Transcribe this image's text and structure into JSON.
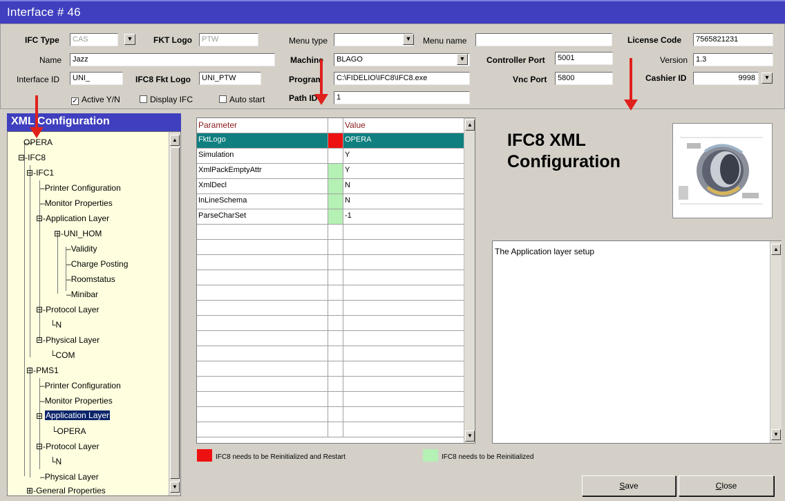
{
  "window": {
    "title": "Interface # 46"
  },
  "header": {
    "ifc_type": {
      "label": "IFC Type",
      "value": "CAS"
    },
    "fkt_logo": {
      "label": "FKT Logo",
      "value": "PTW"
    },
    "menu_type": {
      "label": "Menu type",
      "value": ""
    },
    "menu_name": {
      "label": "Menu name",
      "value": ""
    },
    "license_code": {
      "label": "License Code",
      "value": "7565821231"
    },
    "name": {
      "label": "Name",
      "value": "Jazz"
    },
    "machine": {
      "label": "Machine",
      "value": "BLAGO"
    },
    "controller_port": {
      "label": "Controller Port",
      "value": "5001"
    },
    "version": {
      "label": "Version",
      "value": "1.3"
    },
    "interface_id": {
      "label": "Interface ID",
      "value": "UNI_"
    },
    "ifc8_fkt_logo": {
      "label": "IFC8 Fkt Logo",
      "value": "UNI_PTW"
    },
    "program": {
      "label": "Program",
      "value": "C:\\FIDELIO\\IFC8\\IFC8.exe"
    },
    "vnc_port": {
      "label": "Vnc Port",
      "value": "5800"
    },
    "cashier_id": {
      "label": "Cashier ID",
      "value": "9998"
    },
    "path_id": {
      "label": "Path ID",
      "value": "1"
    },
    "active": {
      "label": "Active Y/N",
      "checked": "✓"
    },
    "display_ifc": {
      "label": "Display IFC"
    },
    "auto_start": {
      "label": "Auto start"
    }
  },
  "tree": {
    "title": "XML Configuration",
    "items": [
      "OPERA",
      "IFC8",
      "IFC1",
      "Printer Configuration",
      "Monitor Properties",
      "Application Layer",
      "UNI_HOM",
      "Validity",
      "Charge Posting",
      "Roomstatus",
      "Minibar",
      "Protocol Layer",
      "N",
      "Physical Layer",
      "COM",
      "PMS1",
      "Printer Configuration",
      "Monitor Properties",
      "Application Layer",
      "OPERA",
      "Protocol Layer",
      "N",
      "Physical Layer",
      "General Properties"
    ]
  },
  "grid": {
    "headers": {
      "parameter": "Parameter",
      "value": "Value"
    },
    "rows": [
      {
        "param": "FktLogo",
        "value": "OPERA"
      },
      {
        "param": "Simulation",
        "value": "Y"
      },
      {
        "param": "XmlPackEmptyAttr",
        "value": "Y"
      },
      {
        "param": "XmlDecl",
        "value": "N"
      },
      {
        "param": "InLineSchema",
        "value": "N"
      },
      {
        "param": "ParseCharSet",
        "value": "-1"
      }
    ]
  },
  "info": {
    "title_line1": "IFC8 XML",
    "title_line2": "Configuration",
    "description": "The Application layer setup"
  },
  "legend": {
    "red_text": "IFC8 needs to be Reinitialized and Restart",
    "green_text": "IFC8 needs to be Reinitialized"
  },
  "buttons": {
    "save_rest": "ave",
    "close_rest": "lose"
  },
  "colors": {
    "restart": "#ee1111",
    "reinit": "#b5f0b5",
    "highlight": "#0f7f7f",
    "title_bar": "#3f3fbf"
  }
}
